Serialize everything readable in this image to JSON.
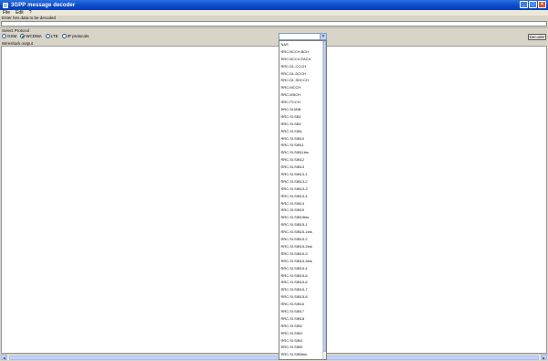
{
  "window": {
    "title": "3GPP message decoder"
  },
  "menu": [
    "File",
    "Edit",
    "?"
  ],
  "labels": {
    "hex": "Enter hex data to be decoded",
    "protocol": "Select Protocol",
    "output": "Wireshark output"
  },
  "protocols": [
    {
      "label": "GSM",
      "selected": false
    },
    {
      "label": "WCDMA",
      "selected": true
    },
    {
      "label": "LTE",
      "selected": false
    },
    {
      "label": "IP protocols",
      "selected": false
    }
  ],
  "decoder_button": "Decoder",
  "combo": {
    "value": ""
  },
  "dropdown_items": [
    "NAS",
    "RRC.BCCH.BCH",
    "RRC.BCCH.FACH",
    "RRC.DL.CCCH",
    "RRC.DL.DCCH",
    "RRC.DL.SHCCH",
    "RRC.MCCH",
    "RRC.MSCH",
    "RRC.PCCH",
    "RRC.SI.MIB",
    "RRC.SI.SB1",
    "RRC.SI.SB2",
    "RRC.SI.SIB1",
    "RRC.SI.SIB10",
    "RRC.SI.SIB11",
    "RRC.SI.SIB11bis",
    "RRC.SI.SIB12",
    "RRC.SI.SIB13",
    "RRC.SI.SIB13-1",
    "RRC.SI.SIB13-2",
    "RRC.SI.SIB13-3",
    "RRC.SI.SIB13-4",
    "RRC.SI.SIB14",
    "RRC.SI.SIB15",
    "RRC.SI.SIB15bis",
    "RRC.SI.SIB15-1",
    "RRC.SI.SIB15-1bis",
    "RRC.SI.SIB15-2",
    "RRC.SI.SIB15-2bis",
    "RRC.SI.SIB15-3",
    "RRC.SI.SIB15-3bis",
    "RRC.SI.SIB15-4",
    "RRC.SI.SIB15-6",
    "RRC.SI.SIB15-6",
    "RRC.SI.SIB15-7",
    "RRC.SI.SIB15-8",
    "RRC.SI.SIB16",
    "RRC.SI.SIB17",
    "RRC.SI.SIB18",
    "RRC.SI.SIB2",
    "RRC.SI.SIB3",
    "RRC.SI.SIB4",
    "RRC.SI.SIB5",
    "RRC.SI.SIB5bis"
  ]
}
